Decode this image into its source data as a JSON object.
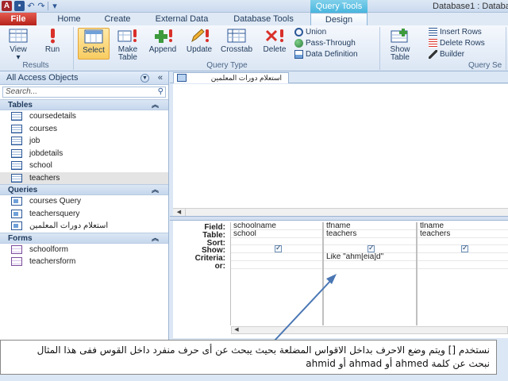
{
  "window": {
    "title": "Database1 : Databa",
    "context_tab_group": "Query Tools"
  },
  "quick_access": {
    "items": [
      "save-icon",
      "undo-icon",
      "redo-icon"
    ]
  },
  "ribbon_tabs": [
    "File",
    "Home",
    "Create",
    "External Data",
    "Database Tools",
    "Design"
  ],
  "ribbon": {
    "results": {
      "label": "Results",
      "buttons": [
        "View",
        "Run"
      ]
    },
    "query_type": {
      "label": "Query Type",
      "buttons": [
        "Select",
        "Make\nTable",
        "Append",
        "Update",
        "Crosstab",
        "Delete"
      ],
      "small": [
        "Union",
        "Pass-Through",
        "Data Definition"
      ]
    },
    "query_setup": {
      "label": "Query Se",
      "show_table": "Show\nTable",
      "small": [
        "Insert Rows",
        "Delete Rows",
        "Builder"
      ]
    }
  },
  "nav": {
    "header": "All Access Objects",
    "search_placeholder": "Search...",
    "sections": [
      {
        "title": "Tables",
        "items": [
          "coursedetails",
          "courses",
          "job",
          "jobdetails",
          "school",
          "teachers"
        ]
      },
      {
        "title": "Queries",
        "items": [
          "courses Query",
          "teachersquery",
          "استعلام دورات المعلمين"
        ]
      },
      {
        "title": "Forms",
        "items": [
          "schoolform",
          "teachersform"
        ]
      }
    ]
  },
  "document_tab": "استعلام دورات المعلمين",
  "design_grid": {
    "row_labels": [
      "Field:",
      "Table:",
      "Sort:",
      "Show:",
      "Criteria:",
      "or:"
    ],
    "columns": [
      {
        "field": "schoolname",
        "table": "school",
        "show": true,
        "criteria": ""
      },
      {
        "field": "tfname",
        "table": "teachers",
        "show": true,
        "criteria": "Like \"ahm[eia]d\""
      },
      {
        "field": "tlname",
        "table": "teachers",
        "show": true,
        "criteria": ""
      }
    ]
  },
  "callout": {
    "line1": "نستخدم [] ويتم وضع الاحرف بداخل الاقواس المضلعة بحيث يبحث عن أى حرف منفرد داخل القوس ففى هذا المثال",
    "line2": "نبحث عن كلمة ahmed أو ahmad أو ahmid"
  }
}
